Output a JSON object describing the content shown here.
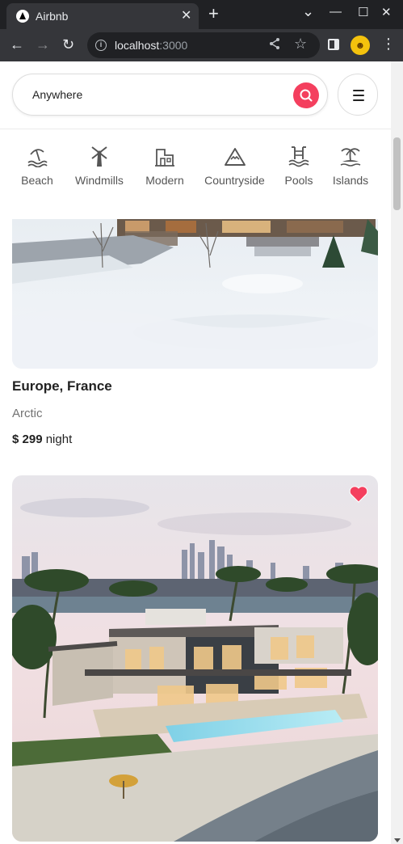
{
  "browser": {
    "tab_title": "Airbnb",
    "tab_close": "✕",
    "new_tab": "+",
    "url_host": "localhost",
    "url_port": ":3000",
    "window_controls": {
      "dropdown": "⌄",
      "minimize": "—",
      "maximize": "☐",
      "close": "✕"
    },
    "nav": {
      "back": "←",
      "forward": "→",
      "reload": "↻"
    },
    "menu": "⋮"
  },
  "header": {
    "search_label": "Anywhere",
    "accent_color": "#f43f5e"
  },
  "categories": [
    {
      "label": "Beach",
      "icon": "beach-icon"
    },
    {
      "label": "Windmills",
      "icon": "windmill-icon"
    },
    {
      "label": "Modern",
      "icon": "modern-icon"
    },
    {
      "label": "Countryside",
      "icon": "countryside-icon"
    },
    {
      "label": "Pools",
      "icon": "pool-icon"
    },
    {
      "label": "Islands",
      "icon": "island-icon"
    }
  ],
  "listings": [
    {
      "location": "Europe, France",
      "category": "Arctic",
      "currency": "$",
      "price": "299",
      "price_unit": "night",
      "favorited": false
    },
    {
      "favorited": true
    }
  ]
}
